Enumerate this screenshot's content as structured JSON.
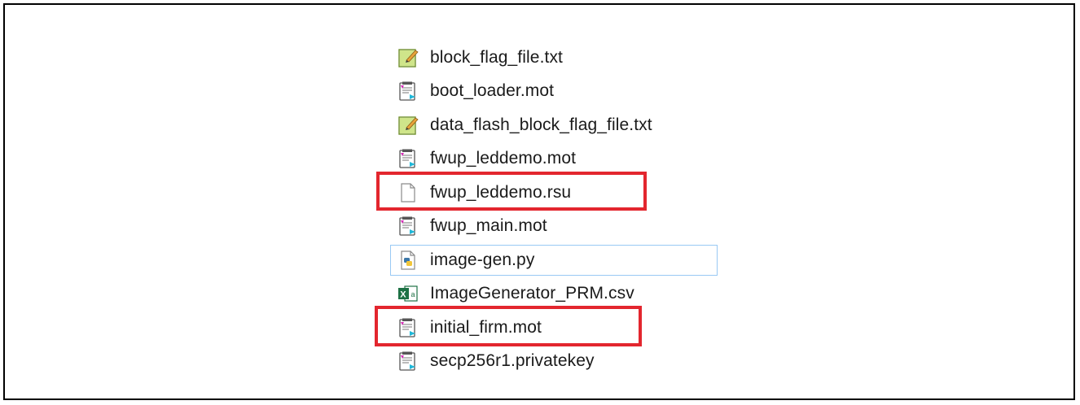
{
  "files": [
    {
      "name": "block_flag_file.txt",
      "icon": "text-file-icon"
    },
    {
      "name": "boot_loader.mot",
      "icon": "mot-file-icon"
    },
    {
      "name": "data_flash_block_flag_file.txt",
      "icon": "text-file-icon"
    },
    {
      "name": "fwup_leddemo.mot",
      "icon": "mot-file-icon"
    },
    {
      "name": "fwup_leddemo.rsu",
      "icon": "blank-file-icon"
    },
    {
      "name": "fwup_main.mot",
      "icon": "mot-file-icon"
    },
    {
      "name": "image-gen.py",
      "icon": "python-file-icon"
    },
    {
      "name": "ImageGenerator_PRM.csv",
      "icon": "excel-csv-file-icon"
    },
    {
      "name": "initial_firm.mot",
      "icon": "mot-file-icon"
    },
    {
      "name": "secp256r1.privatekey",
      "icon": "mot-file-icon"
    }
  ],
  "highlight_color": "#e3262e",
  "selection_border_color": "#99c9f4"
}
